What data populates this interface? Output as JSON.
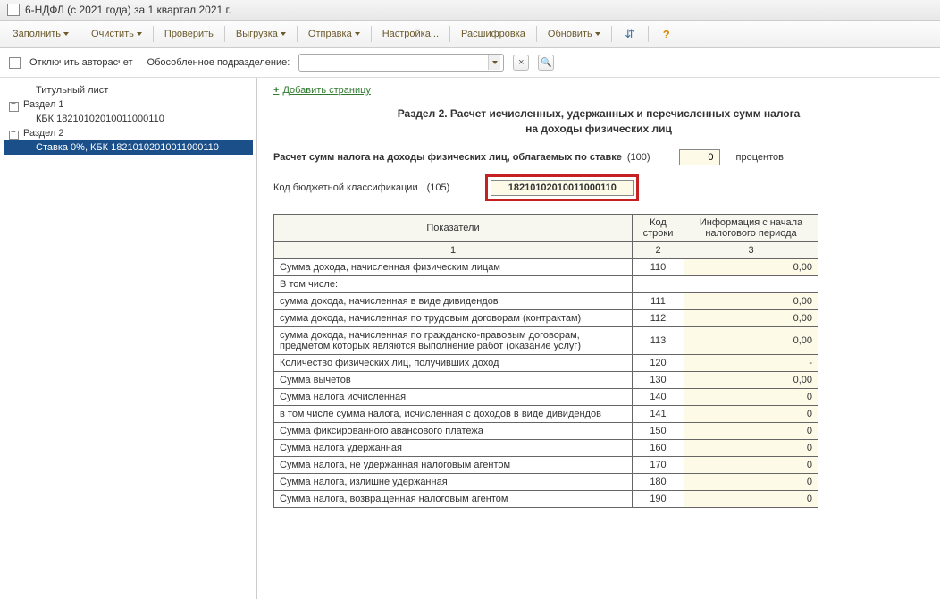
{
  "window": {
    "title": "6-НДФЛ (с 2021 года) за 1 квартал 2021 г."
  },
  "toolbar": {
    "fill": "Заполнить",
    "clear": "Очистить",
    "check": "Проверить",
    "export": "Выгрузка",
    "send": "Отправка",
    "settings": "Настройка...",
    "decode": "Расшифровка",
    "refresh": "Обновить"
  },
  "options": {
    "disable_autocalc": "Отключить авторасчет",
    "subdivision_label": "Обособленное подразделение:"
  },
  "tree": {
    "title_page": "Титульный лист",
    "section1": "Раздел 1",
    "section1_kbk": "КБК 18210102010011000110",
    "section2": "Раздел 2",
    "section2_rate": "Ставка 0%, КБК 18210102010011000110"
  },
  "content": {
    "add_page": "Добавить страницу",
    "section_title_l1": "Раздел 2. Расчет исчисленных, удержанных и перечисленных сумм налога",
    "section_title_l2": "на доходы физических лиц",
    "rate_label": "Расчет сумм налога на доходы физических лиц, облагаемых по ставке",
    "rate_code": "(100)",
    "rate_value": "0",
    "rate_suffix": "процентов",
    "kbk_label": "Код бюджетной классификации",
    "kbk_code_label": "(105)",
    "kbk_value": "18210102010011000110",
    "table": {
      "h_indicator": "Показатели",
      "h_code": "Код строки",
      "h_info": "Информация с начала налогового периода",
      "sub1": "1",
      "sub2": "2",
      "sub3": "3",
      "rows": [
        {
          "label": "Сумма дохода, начисленная физическим лицам",
          "code": "110",
          "val": "0,00",
          "indent": false
        },
        {
          "label": "В том числе:",
          "code": "",
          "val": "",
          "indent": true
        },
        {
          "label": "сумма дохода, начисленная в виде дивидендов",
          "code": "111",
          "val": "0,00",
          "indent": true
        },
        {
          "label": "сумма дохода, начисленная по трудовым договорам (контрактам)",
          "code": "112",
          "val": "0,00",
          "indent": true
        },
        {
          "label": "сумма дохода, начисленная по гражданско-правовым договорам, предметом которых являются выполнение работ (оказание услуг)",
          "code": "113",
          "val": "0,00",
          "indent": true
        },
        {
          "label": "Количество физических лиц, получивших доход",
          "code": "120",
          "val": "-",
          "indent": false
        },
        {
          "label": "Сумма вычетов",
          "code": "130",
          "val": "0,00",
          "indent": false
        },
        {
          "label": "Сумма налога исчисленная",
          "code": "140",
          "val": "0",
          "indent": false
        },
        {
          "label": "в том числе сумма налога, исчисленная с доходов в виде дивидендов",
          "code": "141",
          "val": "0",
          "indent": true
        },
        {
          "label": "Сумма фиксированного авансового платежа",
          "code": "150",
          "val": "0",
          "indent": false
        },
        {
          "label": "Сумма налога удержанная",
          "code": "160",
          "val": "0",
          "indent": false
        },
        {
          "label": "Сумма налога, не удержанная налоговым агентом",
          "code": "170",
          "val": "0",
          "indent": false
        },
        {
          "label": "Сумма налога, излишне удержанная",
          "code": "180",
          "val": "0",
          "indent": false
        },
        {
          "label": "Сумма налога, возвращенная налоговым агентом",
          "code": "190",
          "val": "0",
          "indent": false
        }
      ]
    }
  }
}
